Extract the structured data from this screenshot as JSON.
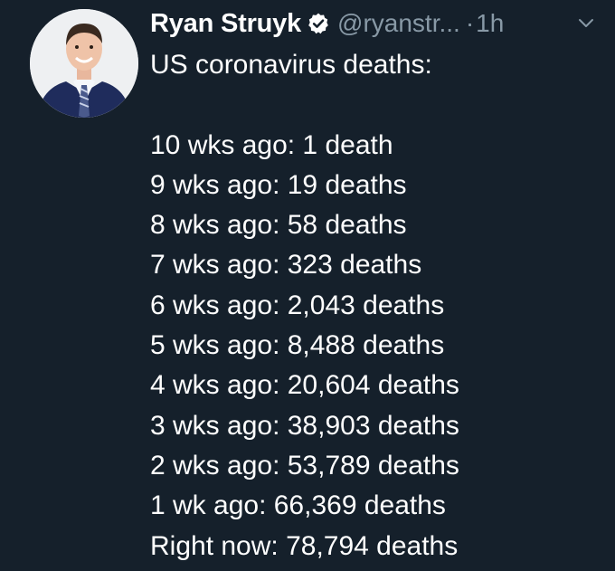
{
  "author": {
    "name": "Ryan Struyk",
    "handle": "@ryanstr...",
    "separator": "·",
    "time": "1h",
    "verified_icon": "verified-badge-icon",
    "menu_icon": "chevron-down-icon"
  },
  "tweet": {
    "heading": "US coronavirus deaths:",
    "lines": [
      "10 wks ago: 1 death",
      "9 wks ago: 19 deaths",
      "8 wks ago: 58 deaths",
      "7 wks ago: 323 deaths",
      "6 wks ago: 2,043 deaths",
      "5 wks ago: 8,488 deaths",
      "4 wks ago: 20,604 deaths",
      "3 wks ago: 38,903 deaths",
      "2 wks ago: 53,789 deaths",
      "1 wk ago: 66,369 deaths",
      "Right now: 78,794 deaths"
    ]
  },
  "colors": {
    "background": "#15202b",
    "text": "#ffffff",
    "muted": "#8899a6",
    "verified": "#ffffff"
  }
}
